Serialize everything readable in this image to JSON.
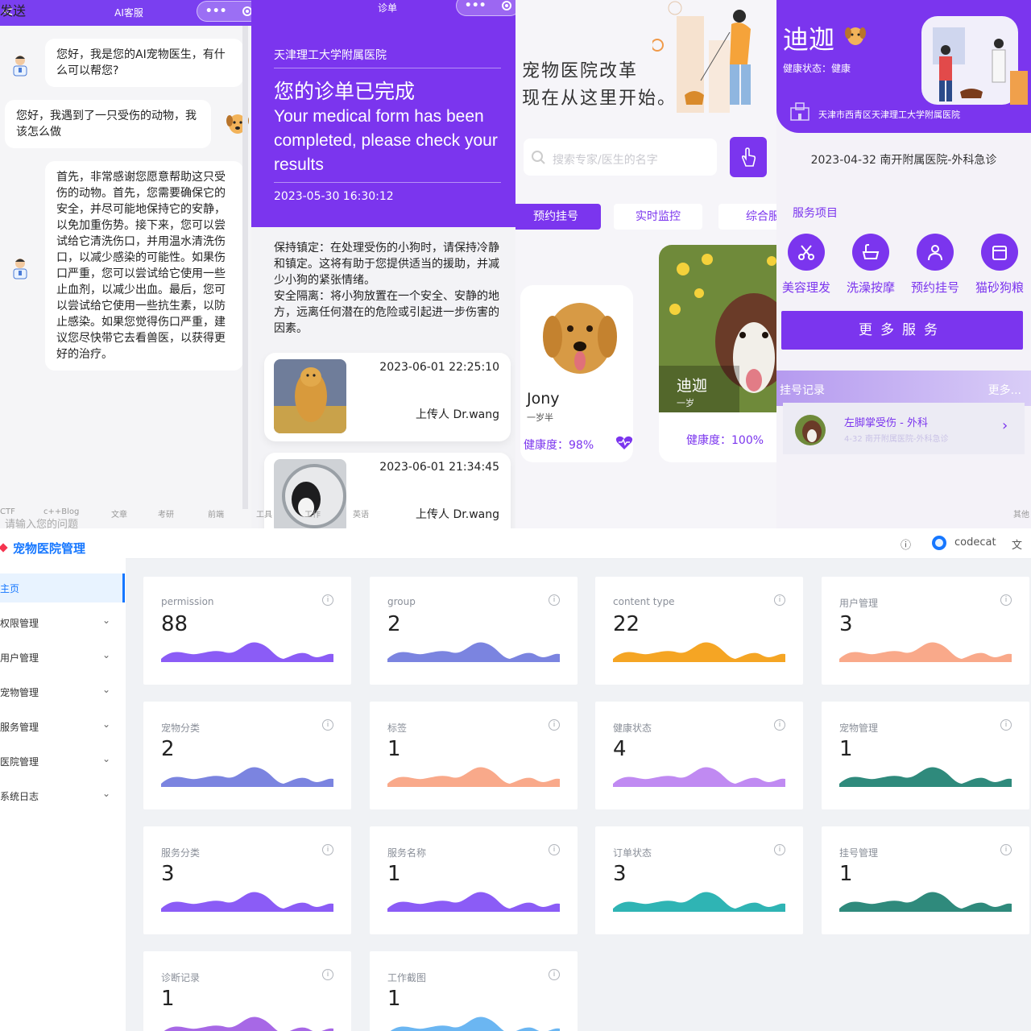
{
  "chat": {
    "title": "AI客服",
    "back": "<",
    "messages": [
      {
        "from": "doctor",
        "text": "您好，我是您的AI宠物医生，有什么可以帮您?"
      },
      {
        "from": "user",
        "text": "您好，我遇到了一只受伤的动物，我该怎么做"
      },
      {
        "from": "doctor",
        "text": "首先，非常感谢您愿意帮助这只受伤的动物。首先，您需要确保它的安全，并尽可能地保持它的安静，以免加重伤势。接下来，您可以尝试给它清洗伤口，并用温水清洗伤口，以减少感染的可能性。如果伤口严重，您可以尝试给它使用一些止血剂，以减少出血。最后，您可以尝试给它使用一些抗生素，以防止感染。如果您觉得伤口严重，建议您尽快带它去看兽医，以获得更好的治疗。"
      }
    ],
    "input_placeholder": "请输入您的问题",
    "send_label": "发送"
  },
  "diagnosis": {
    "nav_title": "诊单",
    "hospital": "天津理工大学附属医院",
    "heading": "您的诊单已完成",
    "heading_en": "Your medical form has been completed, please check your results",
    "timestamp": "2023-05-30 16:30:12",
    "advice": "保持镇定：在处理受伤的小狗时，请保持冷静和镇定。这将有助于您提供适当的援助，并减少小狗的紧张情绪。\n安全隔离：将小狗放置在一个安全、安静的地方，远离任何潜在的危险或引起进一步伤害的因素。",
    "uploads": [
      {
        "time": "2023-06-01 22:25:10",
        "uploader": "上传人 Dr.wang"
      },
      {
        "time": "2023-06-01 21:34:45",
        "uploader": "上传人 Dr.wang"
      }
    ]
  },
  "home": {
    "slogan_line1": "宠物医院改革",
    "slogan_line2": "现在从这里开始。",
    "search_placeholder": "搜索专家/医生的名字",
    "tabs": [
      "预约挂号",
      "实时监控",
      "综合服"
    ],
    "pets": [
      {
        "name": "Jony",
        "age": "一岁半",
        "health": "健康度：98%"
      },
      {
        "name": "迪迦",
        "age": "一岁",
        "health": "健康度：100%"
      }
    ]
  },
  "profile": {
    "name": "迪迦",
    "health_status": "健康状态：健康",
    "address": "天津市西青区天津理工大学附属医院",
    "visit": "2023-04-32 南开附属医院-外科急诊",
    "services_title": "服务项目",
    "services": [
      {
        "label": "美容理发",
        "icon": "scissors-icon"
      },
      {
        "label": "洗澡按摩",
        "icon": "bathtub-icon"
      },
      {
        "label": "预约挂号",
        "icon": "doctor-icon"
      },
      {
        "label": "猫砂狗粮",
        "icon": "food-box-icon"
      }
    ],
    "more_services": "更多服务",
    "records_title": "挂号记录",
    "records_more": "更多...",
    "record": {
      "title": "左脚掌受伤 - 外科",
      "sub": "4-32 南开附属医院-外科急诊"
    }
  },
  "browser_bookmarks": [
    "CTF",
    "c++Blog",
    "文章",
    "考研",
    "前端",
    "工具",
    "工作",
    "英语",
    "其他"
  ],
  "admin": {
    "title": "宠物医院管理",
    "header_user": "codecat",
    "menu": [
      {
        "label": "主页",
        "active": true
      },
      {
        "label": "权限管理"
      },
      {
        "label": "用户管理"
      },
      {
        "label": "宠物管理"
      },
      {
        "label": "服务管理"
      },
      {
        "label": "医院管理"
      },
      {
        "label": "系统日志"
      }
    ],
    "stats": [
      {
        "title": "permission",
        "value": "88",
        "color": "#8b5cf6"
      },
      {
        "title": "group",
        "value": "2",
        "color": "#7b84e0"
      },
      {
        "title": "content type",
        "value": "22",
        "color": "#f5a524"
      },
      {
        "title": "用户管理",
        "value": "3",
        "color": "#f9a98a"
      },
      {
        "title": "宠物分类",
        "value": "2",
        "color": "#7b84e0"
      },
      {
        "title": "标签",
        "value": "1",
        "color": "#f9a98a"
      },
      {
        "title": "健康状态",
        "value": "4",
        "color": "#c08af2"
      },
      {
        "title": "宠物管理",
        "value": "1",
        "color": "#2f8a7c"
      },
      {
        "title": "服务分类",
        "value": "3",
        "color": "#8b5cf6"
      },
      {
        "title": "服务名称",
        "value": "1",
        "color": "#8b5cf6"
      },
      {
        "title": "订单状态",
        "value": "3",
        "color": "#2fb4b4"
      },
      {
        "title": "挂号管理",
        "value": "1",
        "color": "#2f8a7c"
      },
      {
        "title": "诊断记录",
        "value": "1",
        "color": "#a768e6"
      },
      {
        "title": "工作截图",
        "value": "1",
        "color": "#6bb6f2"
      }
    ]
  }
}
